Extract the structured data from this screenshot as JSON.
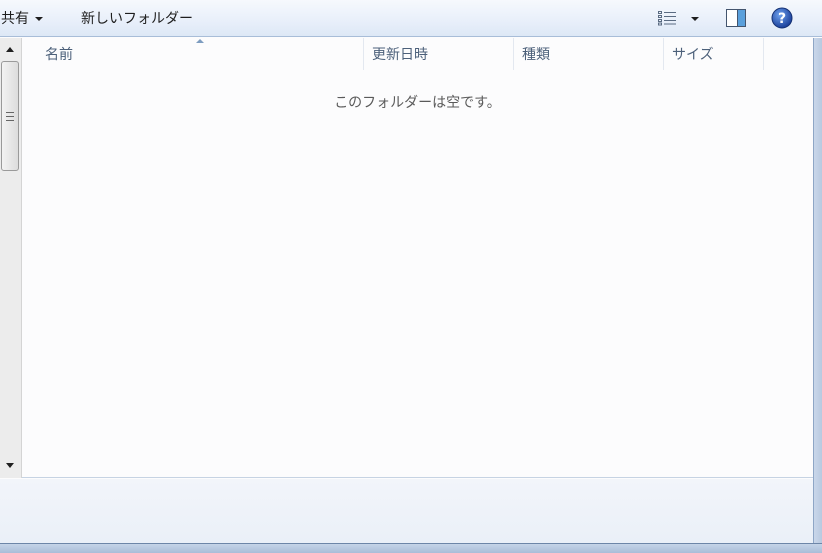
{
  "toolbar": {
    "share_label": "共有",
    "new_folder_label": "新しいフォルダー",
    "views_icon": "details-view-icon",
    "preview_icon": "preview-pane-icon",
    "help_icon": "help-icon"
  },
  "columns": {
    "name": "名前",
    "date_modified": "更新日時",
    "type": "種類",
    "size": "サイズ"
  },
  "content": {
    "empty_message": "このフォルダーは空です。"
  },
  "colors": {
    "toolbar_bg": "#e8effa",
    "header_text": "#4c607a",
    "help_blue": "#1f5bb8"
  }
}
